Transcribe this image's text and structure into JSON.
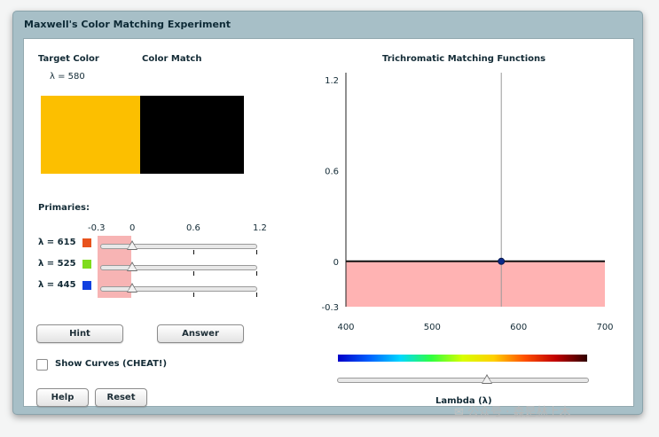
{
  "window": {
    "title": "Maxwell's Color Matching Experiment"
  },
  "left": {
    "target_label": "Target Color",
    "match_label": "Color Match",
    "lambda_text": "λ = 580",
    "target_color": "#fcbf00",
    "match_color": "#000000",
    "primaries_label": "Primaries:",
    "scale_labels": [
      "-0.3",
      "0",
      "0.6",
      "1.2"
    ],
    "primaries": [
      {
        "label": "λ = 615",
        "color": "#e8531d",
        "value": 0
      },
      {
        "label": "λ = 525",
        "color": "#7fdc1d",
        "value": 0
      },
      {
        "label": "λ = 445",
        "color": "#1240e0",
        "value": 0
      }
    ],
    "hint_button": "Hint",
    "answer_button": "Answer",
    "show_curves_label": "Show Curves (CHEAT!)",
    "show_curves_checked": false,
    "help_button": "Help",
    "reset_button": "Reset"
  },
  "chart_data": {
    "type": "line",
    "title": "Trichromatic Matching Functions",
    "xlabel": "Lambda (λ)",
    "ylabel": "",
    "xlim": [
      400,
      700
    ],
    "ylim": [
      -0.3,
      1.2
    ],
    "x_ticks": [
      "400",
      "500",
      "600",
      "700"
    ],
    "y_ticks": [
      "1.2",
      "0.6",
      "0",
      "-0.3"
    ],
    "current_lambda": 580,
    "marker_point": {
      "x": 580,
      "y": 0
    },
    "series": []
  },
  "spectrum_bar": {
    "stops": [
      "#0000c8",
      "#0060ff",
      "#00d8ff",
      "#30ff40",
      "#d8ff00",
      "#ffd000",
      "#ff5000",
      "#c00000",
      "#300000"
    ]
  },
  "lambda_slider": {
    "min": 400,
    "max": 700,
    "value": 580
  },
  "watermark": "公众号 · 森是林上木"
}
